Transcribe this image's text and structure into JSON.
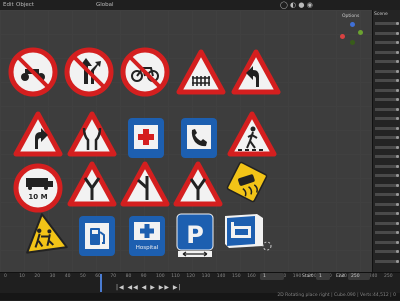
{
  "header": {
    "menus": [
      "Edit",
      "Object"
    ],
    "transform_orientation": "Global",
    "options_label": "Options"
  },
  "ruler": [
    "0",
    "10",
    "20",
    "30",
    "40",
    "50",
    "60",
    "70",
    "80",
    "90",
    "100",
    "110",
    "120",
    "130",
    "140",
    "150",
    "160",
    "170",
    "180",
    "190",
    "200",
    "210",
    "220",
    "230",
    "240",
    "250"
  ],
  "timeline": {
    "current_frame": "1",
    "start_label": "Start",
    "start_value": "1",
    "end_label": "End",
    "end_value": "250"
  },
  "status": {
    "text": "2D Rotating place right | Cube.090 | Verts:44,512 | 0"
  },
  "signs": [
    {
      "name": "no-motorcycles-sign"
    },
    {
      "name": "no-straight-or-right-turn-sign"
    },
    {
      "name": "no-bicycles-sign"
    },
    {
      "name": "level-crossing-with-gates-sign"
    },
    {
      "name": "curve-left-sign"
    },
    {
      "name": "curve-right-sign"
    },
    {
      "name": "road-narrows-sign"
    },
    {
      "name": "first-aid-sign"
    },
    {
      "name": "telephone-sign"
    },
    {
      "name": "pedestrian-crossing-sign"
    },
    {
      "name": "max-length-sign",
      "text": "10 M"
    },
    {
      "name": "y-junction-sign"
    },
    {
      "name": "y-junction-left-sign"
    },
    {
      "name": "y-junction-right-sign"
    },
    {
      "name": "slippery-road-sign"
    },
    {
      "name": "children-crossing-sign"
    },
    {
      "name": "fuel-station-sign"
    },
    {
      "name": "hospital-sign",
      "text": "Hospital"
    },
    {
      "name": "parking-sign",
      "text": "P"
    },
    {
      "name": "hotel-sign"
    }
  ],
  "colors": {
    "red": "#d41f1f",
    "blue": "#1d5fb0",
    "yellow": "#f2c417",
    "white": "#f2f2f2",
    "viewport": "#3d3d3d"
  }
}
